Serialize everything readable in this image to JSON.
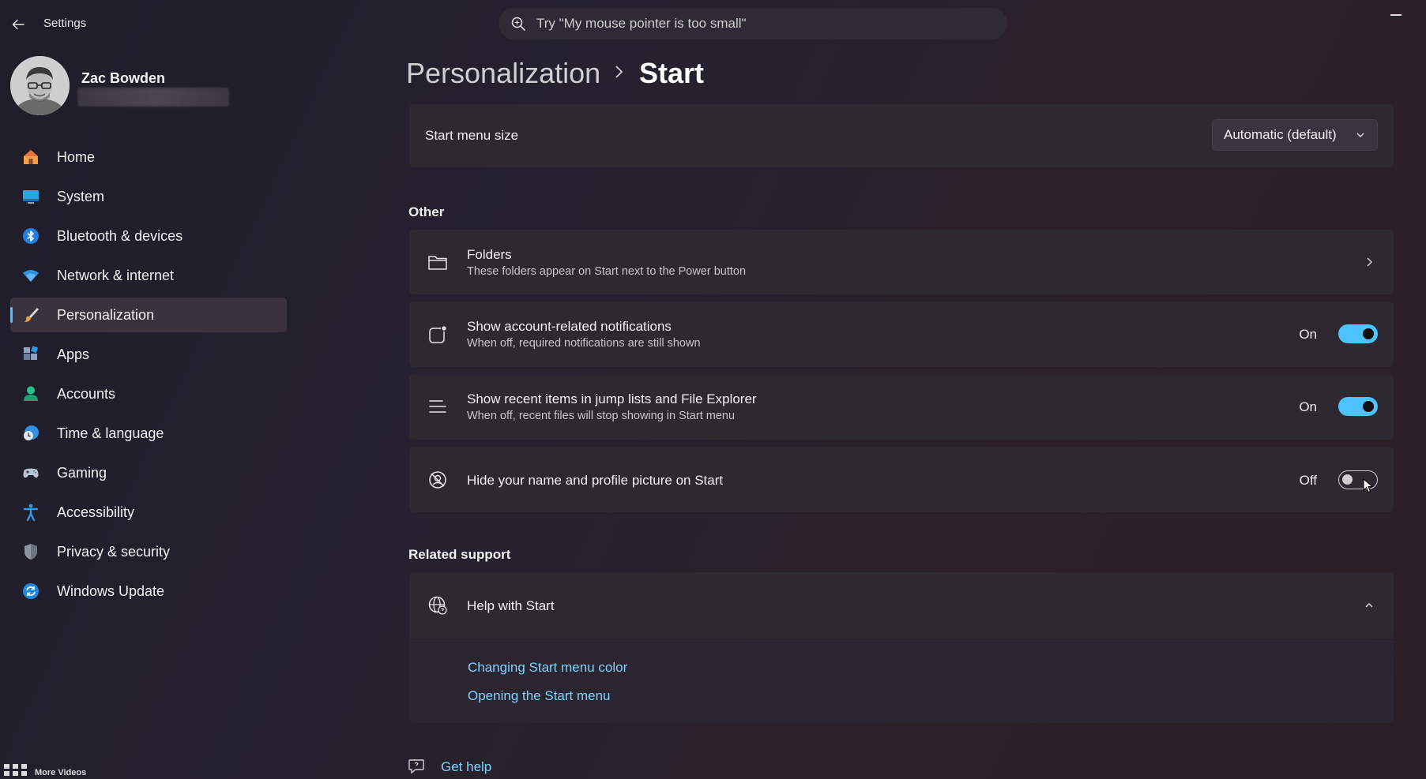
{
  "window": {
    "title": "Settings"
  },
  "search": {
    "placeholder": "Try \"My mouse pointer is too small\""
  },
  "user": {
    "name": "Zac Bowden"
  },
  "sidebar": {
    "items": [
      {
        "label": "Home",
        "icon": "home-icon"
      },
      {
        "label": "System",
        "icon": "system-icon"
      },
      {
        "label": "Bluetooth & devices",
        "icon": "bluetooth-icon"
      },
      {
        "label": "Network & internet",
        "icon": "wifi-icon"
      },
      {
        "label": "Personalization",
        "icon": "paintbrush-icon",
        "active": true
      },
      {
        "label": "Apps",
        "icon": "apps-icon"
      },
      {
        "label": "Accounts",
        "icon": "account-icon"
      },
      {
        "label": "Time & language",
        "icon": "clock-globe-icon"
      },
      {
        "label": "Gaming",
        "icon": "gamepad-icon"
      },
      {
        "label": "Accessibility",
        "icon": "accessibility-icon"
      },
      {
        "label": "Privacy & security",
        "icon": "shield-icon"
      },
      {
        "label": "Windows Update",
        "icon": "update-icon"
      }
    ]
  },
  "breadcrumb": {
    "parent": "Personalization",
    "current": "Start"
  },
  "start_menu_size": {
    "label": "Start menu size",
    "value": "Automatic (default)"
  },
  "other": {
    "title": "Other",
    "folders": {
      "label": "Folders",
      "description": "These folders appear on Start next to the Power button"
    },
    "account_notifications": {
      "label": "Show account-related notifications",
      "description": "When off, required notifications are still shown",
      "state": "On"
    },
    "recent_items": {
      "label": "Show recent items in jump lists and File Explorer",
      "description": "When off, recent files will stop showing in Start menu",
      "state": "On"
    },
    "hide_name": {
      "label": "Hide your name and profile picture on Start",
      "state": "Off"
    }
  },
  "related_support": {
    "title": "Related support",
    "help": {
      "label": "Help with Start"
    },
    "links": [
      "Changing Start menu color",
      "Opening the Start menu"
    ]
  },
  "get_help": {
    "label": "Get help"
  },
  "overlay": {
    "more_videos": "More Videos"
  },
  "colors": {
    "accent": "#4cc2ff",
    "link": "#7fd3ff",
    "card": "#2e2830"
  }
}
